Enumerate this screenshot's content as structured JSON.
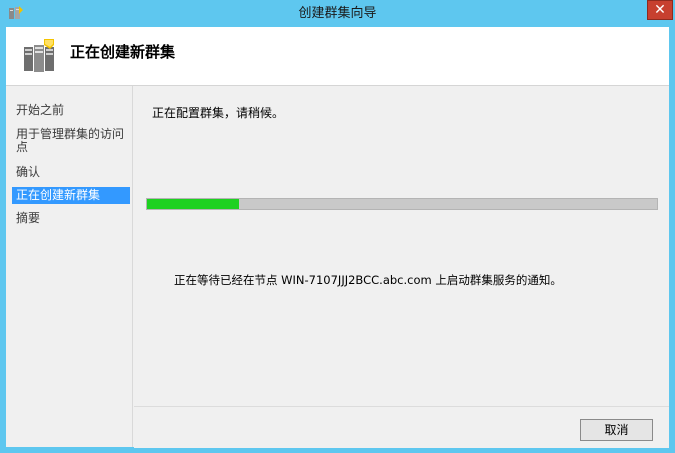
{
  "window": {
    "title": "创建群集向导"
  },
  "header": {
    "title": "正在创建新群集"
  },
  "sidebar": {
    "items": [
      {
        "label": "开始之前"
      },
      {
        "label": "用于管理群集的访问点"
      },
      {
        "label": "确认"
      },
      {
        "label": "正在创建新群集"
      },
      {
        "label": "摘要"
      }
    ],
    "active_index": 3
  },
  "main": {
    "status": "正在配置群集，请稍候。",
    "progress_percent": 18,
    "wait_message": "正在等待已经在节点 WIN-7107JJJ2BCC.abc.com 上启动群集服务的通知。"
  },
  "footer": {
    "cancel_label": "取消"
  },
  "icons": {
    "app": "cluster-wizard-icon",
    "header": "cluster-servers-icon",
    "close": "close-icon"
  },
  "colors": {
    "titlebar": "#5ec7ef",
    "close": "#c7402f",
    "selection": "#3399ff",
    "progress_fill": "#1ed121",
    "progress_track": "#c9c9c9"
  }
}
